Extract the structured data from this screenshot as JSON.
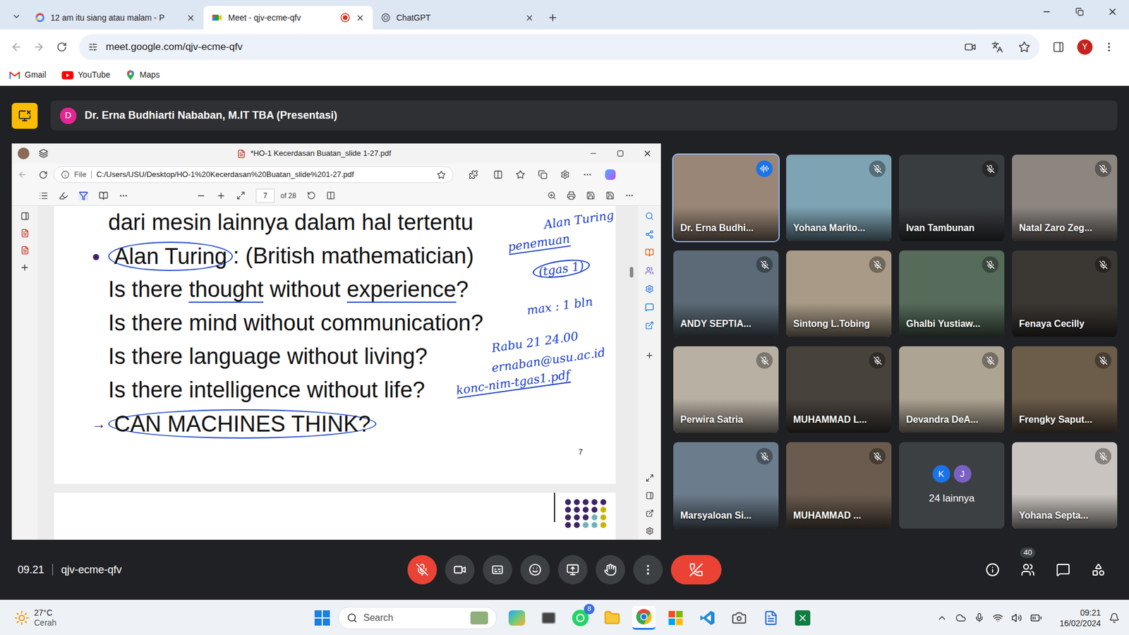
{
  "browser": {
    "tabs": [
      {
        "title": "12 am itu siang atau malam - P",
        "selected": false,
        "recording": false
      },
      {
        "title": "Meet - qjv-ecme-qfv",
        "selected": true,
        "recording": true
      },
      {
        "title": "ChatGPT",
        "selected": false,
        "recording": false
      }
    ],
    "url": "meet.google.com/qjv-ecme-qfv",
    "profile": "Y",
    "bookmarks": [
      "Gmail",
      "YouTube",
      "Maps"
    ]
  },
  "presenter": {
    "initial": "D",
    "label": "Dr. Erna Budhiarti Nababan, M.IT TBA (Presentasi)"
  },
  "pdf_viewer": {
    "title": "*HO-1 Kecerdasan Buatan_slide 1-27.pdf",
    "scheme": "File",
    "path": "C:/Users/USU/Desktop/HO-1%20Kecerdasan%20Buatan_slide%201-27.pdf",
    "page": "7",
    "page_total": "of 28",
    "slide": {
      "lines": [
        {
          "marker": "",
          "segments": [
            {
              "text": "dari mesin lainnya dalam hal tertentu",
              "mark": "none"
            }
          ]
        },
        {
          "marker": "●",
          "segments": [
            {
              "text": "Alan Turing",
              "mark": "circle"
            },
            {
              "text": ": (British mathematician)",
              "mark": "none"
            }
          ]
        },
        {
          "marker": "",
          "segments": [
            {
              "text": "Is there ",
              "mark": "none"
            },
            {
              "text": "thought",
              "mark": "underline"
            },
            {
              "text": " without ",
              "mark": "none"
            },
            {
              "text": "experience",
              "mark": "underline"
            },
            {
              "text": "?",
              "mark": "none"
            }
          ]
        },
        {
          "marker": "",
          "segments": [
            {
              "text": "Is there mind without communication?",
              "mark": "none"
            }
          ]
        },
        {
          "marker": "",
          "segments": [
            {
              "text": "Is there language without living?",
              "mark": "none"
            }
          ]
        },
        {
          "marker": "",
          "segments": [
            {
              "text": "Is there intelligence without life?",
              "mark": "none"
            }
          ]
        },
        {
          "marker": "→",
          "segments": [
            {
              "text": "CAN MACHINES THINK?",
              "mark": "circle"
            }
          ]
        }
      ],
      "page_number": "7"
    },
    "annotations": [
      {
        "text": "Alan Turing",
        "mark": "none"
      },
      {
        "text": "penemuan",
        "mark": "underline"
      },
      {
        "text": "(tgas 1)",
        "mark": "circle"
      },
      {
        "text": "max : 1 bln",
        "mark": "none"
      },
      {
        "text": "Rabu 21 24.00",
        "mark": "none"
      },
      {
        "text": "ernaban@usu.ac.id",
        "mark": "none"
      },
      {
        "text": "konc-nim-tgas1.pdf",
        "mark": "underline"
      }
    ]
  },
  "participants": [
    {
      "name": "Dr. Erna Budhi...",
      "muted": false,
      "speaking": true,
      "color": "#9a8676"
    },
    {
      "name": "Yohana Marito...",
      "muted": true,
      "speaking": false,
      "color": "#7ea3b3"
    },
    {
      "name": "Ivan Tambunan",
      "muted": true,
      "speaking": false,
      "color": "#3a3d40"
    },
    {
      "name": "Natal Zaro Zeg...",
      "muted": true,
      "speaking": false,
      "color": "#8c8580"
    },
    {
      "name": "ANDY SEPTIA...",
      "muted": true,
      "speaking": false,
      "color": "#5b6a76"
    },
    {
      "name": "Sintong L.Tobing",
      "muted": true,
      "speaking": false,
      "color": "#a89a86"
    },
    {
      "name": "Ghalbi Yustiaw...",
      "muted": true,
      "speaking": false,
      "color": "#566b5a"
    },
    {
      "name": "Fenaya Cecilly",
      "muted": true,
      "speaking": false,
      "color": "#3b3733"
    },
    {
      "name": "Perwira Satria",
      "muted": true,
      "speaking": false,
      "color": "#b9b0a4"
    },
    {
      "name": "MUHAMMAD L...",
      "muted": true,
      "speaking": false,
      "color": "#48423c"
    },
    {
      "name": "Devandra DeA...",
      "muted": true,
      "speaking": false,
      "color": "#aea493"
    },
    {
      "name": "Frengky Saput...",
      "muted": true,
      "speaking": false,
      "color": "#6c5c4a"
    },
    {
      "name": "Marsyaloan Si...",
      "muted": true,
      "speaking": false,
      "color": "#6b7c8c"
    },
    {
      "name": "MUHAMMAD ...",
      "muted": true,
      "speaking": false,
      "color": "#6a5b4e"
    },
    {
      "name": "Yohana Septa...",
      "muted": true,
      "speaking": false,
      "color": "#c9c4bf"
    }
  ],
  "others": {
    "initials": [
      {
        "letter": "K",
        "color": "#1a73e8"
      },
      {
        "letter": "J",
        "color": "#7b61c4"
      }
    ],
    "label": "24 lainnya"
  },
  "meeting_bar": {
    "time": "09.21",
    "code": "qjv-ecme-qfv",
    "mic_on": false,
    "people_count": "40"
  },
  "taskbar": {
    "temperature": "27°C",
    "weather": "Cerah",
    "search": "Search",
    "whatsapp_badge": "8",
    "time": "09:21",
    "date": "16/02/2024"
  }
}
